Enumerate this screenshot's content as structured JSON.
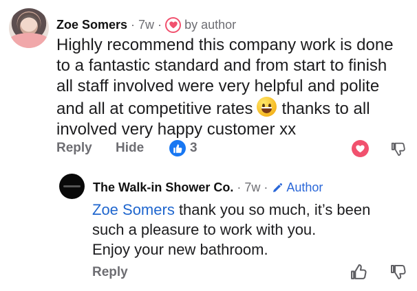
{
  "colors": {
    "text": "#1c1c1e",
    "muted": "#6d6d72",
    "accent_blue": "#1877f2",
    "link_blue": "#1f66ce",
    "heart_red": "#f1516e"
  },
  "comment": {
    "author": "Zoe Somers",
    "time": "7w",
    "badge_icon": "heart-icon",
    "badge_text": "by author",
    "avatar_icon": "profile-photo",
    "text_lines": [
      "Highly recommend this company work is done",
      "to a fantastic standard and from start to finish",
      "all staff involved were very helpful and polite",
      "and all at competitive rates",
      "thanks to all",
      "involved very happy customer xx"
    ],
    "emoji": "grinning-face-emoji",
    "actions": {
      "reply": "Reply",
      "hide": "Hide",
      "likes": "3"
    }
  },
  "reply": {
    "author": "The Walk-in Shower Co.",
    "time": "7w",
    "badge_icon": "pencil-icon",
    "badge_text": "Author",
    "mention": "Zoe Somers",
    "text_lines": [
      " thank you so much, it’s been",
      "such a pleasure to work with you.",
      "Enjoy your new bathroom."
    ],
    "action": "Reply"
  },
  "separators": {
    "dot": "·"
  }
}
